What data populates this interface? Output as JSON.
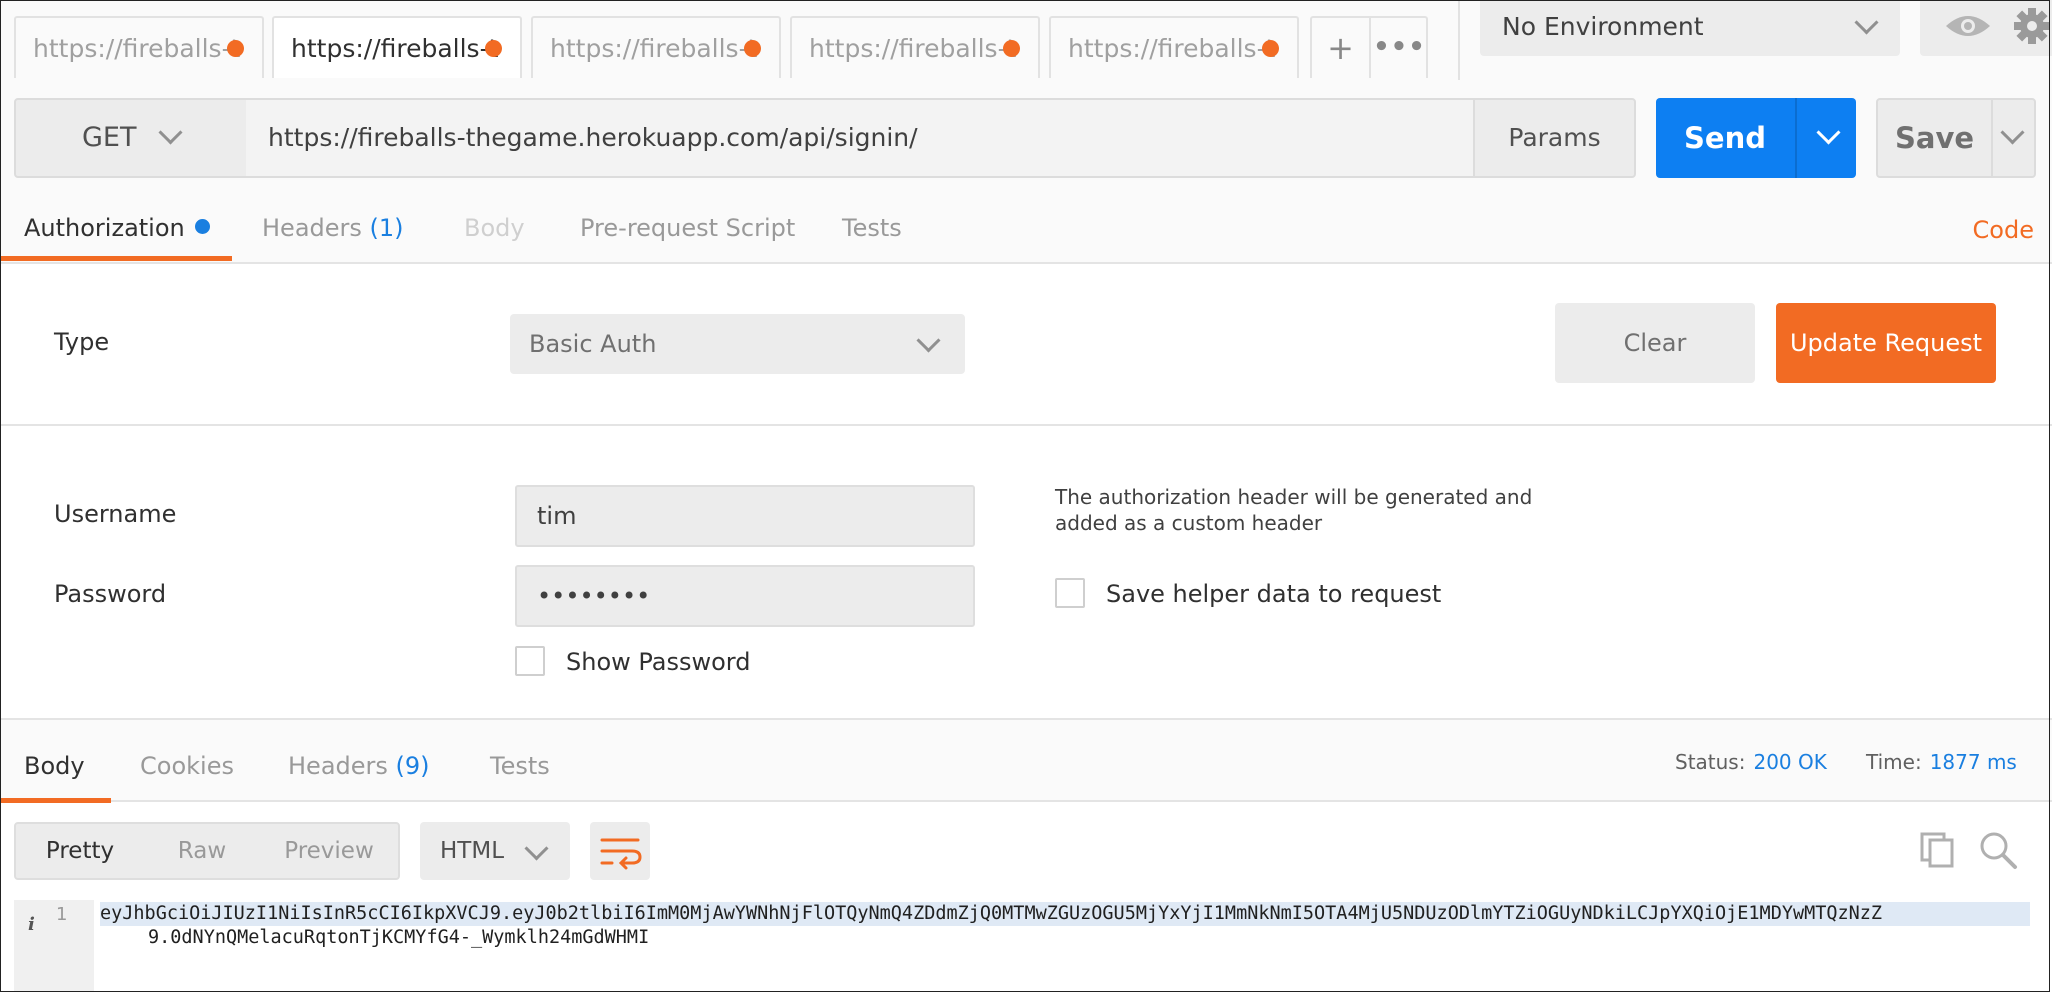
{
  "tabs": [
    {
      "label": "https://fireballs-t",
      "active": false
    },
    {
      "label": "https://fireballs-t",
      "active": true
    },
    {
      "label": "https://fireballs-t",
      "active": false
    },
    {
      "label": "https://fireballs-t",
      "active": false
    },
    {
      "label": "https://fireballs-t",
      "active": false
    }
  ],
  "tab_actions": {
    "add_label": "+",
    "more_label": "•••"
  },
  "environment": {
    "selected": "No Environment"
  },
  "request": {
    "method": "GET",
    "url": "https://fireballs-thegame.herokuapp.com/api/signin/",
    "params_label": "Params",
    "send_label": "Send",
    "save_label": "Save"
  },
  "request_tabs": {
    "authorization": "Authorization",
    "headers": "Headers",
    "headers_count": "(1)",
    "body": "Body",
    "prerequest": "Pre-request Script",
    "tests": "Tests",
    "code_link": "Code"
  },
  "auth": {
    "type_label": "Type",
    "type_value": "Basic Auth",
    "clear_label": "Clear",
    "update_label": "Update Request",
    "username_label": "Username",
    "username_value": "tim",
    "password_label": "Password",
    "password_value": "••••••••",
    "show_password_label": "Show Password",
    "hint": "The authorization header will be generated and added as a custom header",
    "save_helper_label": "Save helper data to request"
  },
  "response": {
    "tabs": {
      "body": "Body",
      "cookies": "Cookies",
      "headers": "Headers",
      "headers_count": "(9)",
      "tests": "Tests"
    },
    "status_label": "Status:",
    "status_value": "200 OK",
    "time_label": "Time:",
    "time_value": "1877 ms",
    "view_modes": {
      "pretty": "Pretty",
      "raw": "Raw",
      "preview": "Preview"
    },
    "format": "HTML",
    "line_number": "1",
    "body_text_line1": "eyJhbGciOiJIUzI1NiIsInR5cCI6IkpXVCJ9.eyJ0b2tlbiI6ImM0MjAwYWNhNjFlOTQyNmQ4ZDdmZjQ0MTMwZGUzOGU5MjYxYjI1MmNkNmI5OTA4MjU5NDUzODlmYTZiOGUyNDkiLCJpYXQiOjE1MDYwMTQzNzZ",
    "body_text_line2": "9.0dNYnQMelacuRqtonTjKCMYfG4-_Wymklh24mGdWHMI"
  },
  "colors": {
    "accent": "#f26b23",
    "primary": "#0d7ff2",
    "link": "#1a7fe0"
  }
}
